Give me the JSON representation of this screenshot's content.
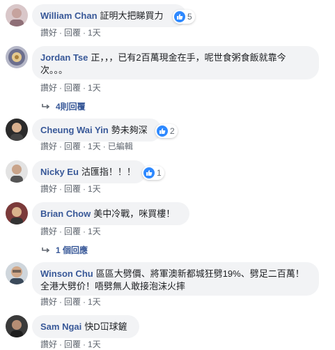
{
  "actions": {
    "like": "讚好",
    "reply": "回覆",
    "sep": "·"
  },
  "comments": [
    {
      "author": "William Chan",
      "text": "証明大把睇買力",
      "reactions": "5",
      "time": "1天",
      "edited": ""
    },
    {
      "author": "Jordan Tse",
      "text": "正，，，已有2百萬現金在手，呢世食粥食飯就靠今次。。。",
      "reactions": "",
      "time": "1天",
      "edited": "",
      "replies": "4則回覆"
    },
    {
      "author": "Cheung Wai Yin",
      "text": "勢未夠深",
      "reactions": "2",
      "time": "1天",
      "edited": "已編輯"
    },
    {
      "author": "Nicky Eu",
      "text": "沽匯指！！！",
      "reactions": "1",
      "time": "1天",
      "edited": ""
    },
    {
      "author": "Brian Chow",
      "text": "美中冷戰，咪買樓！",
      "reactions": "",
      "time": "1天",
      "edited": "",
      "replies": "1 個回應"
    },
    {
      "author": "Winson Chu",
      "text": "區區大劈價、將軍澳新都城狂劈19%、劈足二百萬！全港大劈价！唔劈無人敢接泡沫火摔",
      "reactions": "",
      "time": "1天",
      "edited": ""
    },
    {
      "author": "Sam Ngai",
      "text": "快D冚球鏟",
      "reactions": "",
      "time": "1天",
      "edited": ""
    }
  ],
  "colors": {
    "bubble": "#f2f3f5",
    "author": "#385898",
    "meta": "#606770",
    "like": "#2e89ff"
  },
  "icons": {
    "reply_arrow": "reply-arrow-icon",
    "like": "thumbs-up-icon"
  }
}
